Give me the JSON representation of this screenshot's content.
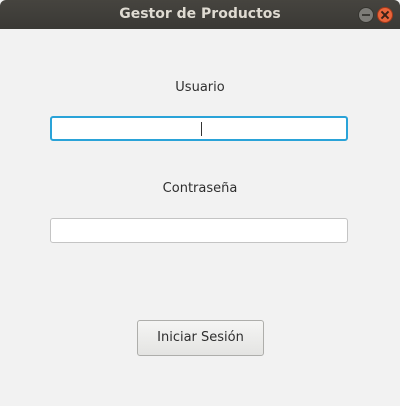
{
  "window": {
    "title": "Gestor de Productos",
    "controls": [
      "minimize",
      "close"
    ]
  },
  "form": {
    "user_label": "Usuario",
    "user_value": "",
    "password_label": "Contraseña",
    "password_value": "",
    "login_button": "Iniciar Sesión"
  },
  "colors": {
    "titlebar": "#3c3b37",
    "focus_border": "#2aa3d8",
    "close_button": "#e9653b",
    "background": "#f2f2f2"
  }
}
